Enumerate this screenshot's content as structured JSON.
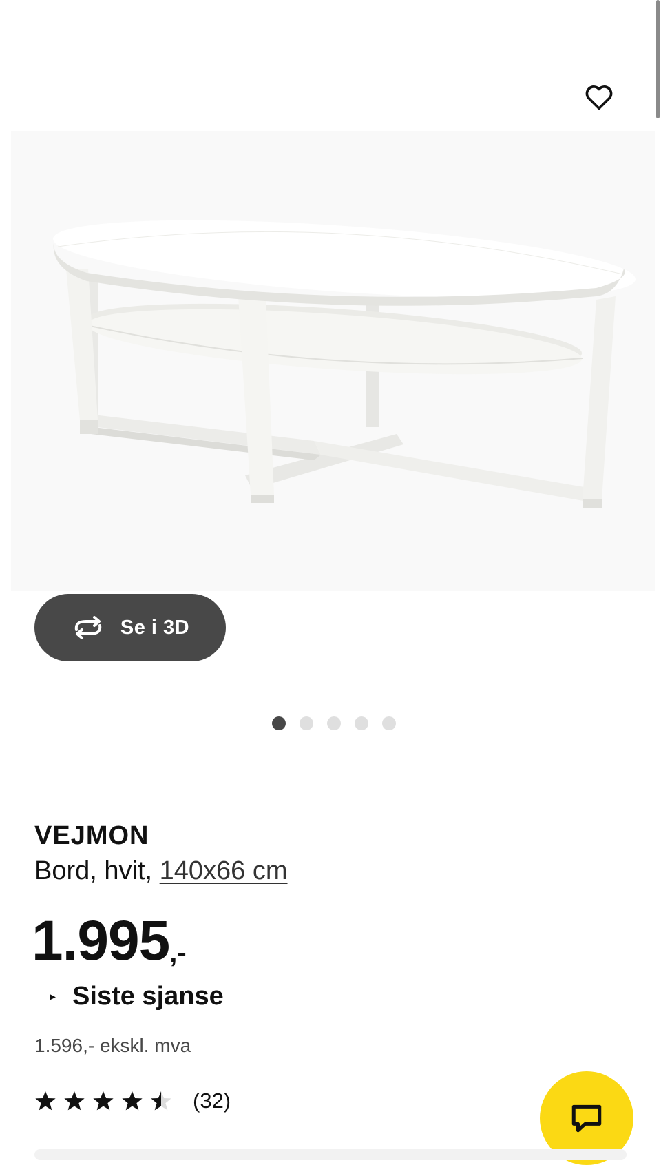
{
  "icons": {
    "favorite": "heart-outline-icon",
    "view_3d": "rotate-3d-icon",
    "tag_arrow": "triangle-right-icon",
    "chat": "chat-bubble-icon",
    "star_full": "star-icon",
    "star_half": "star-half-icon"
  },
  "colors": {
    "button_3d": "#484848",
    "chat_button": "#fbd914",
    "dot_active": "#484848",
    "dot_inactive": "#dfdfdf"
  },
  "gallery": {
    "image_alt": "VEJMON",
    "slide_count": 5,
    "active_index": 0
  },
  "view3d": {
    "label": "Se i 3D"
  },
  "product": {
    "name": "VEJMON",
    "description_prefix": "Bord, hvit,",
    "size": "140x66 cm",
    "price_main": "1.995",
    "price_suffix": ",-",
    "tag_arrow": "▸",
    "tag": "Siste sjanse",
    "price_excl": "1.596,- ekskl. mva"
  },
  "rating": {
    "value": 4.5,
    "max": 5,
    "count_label": "(32)"
  }
}
